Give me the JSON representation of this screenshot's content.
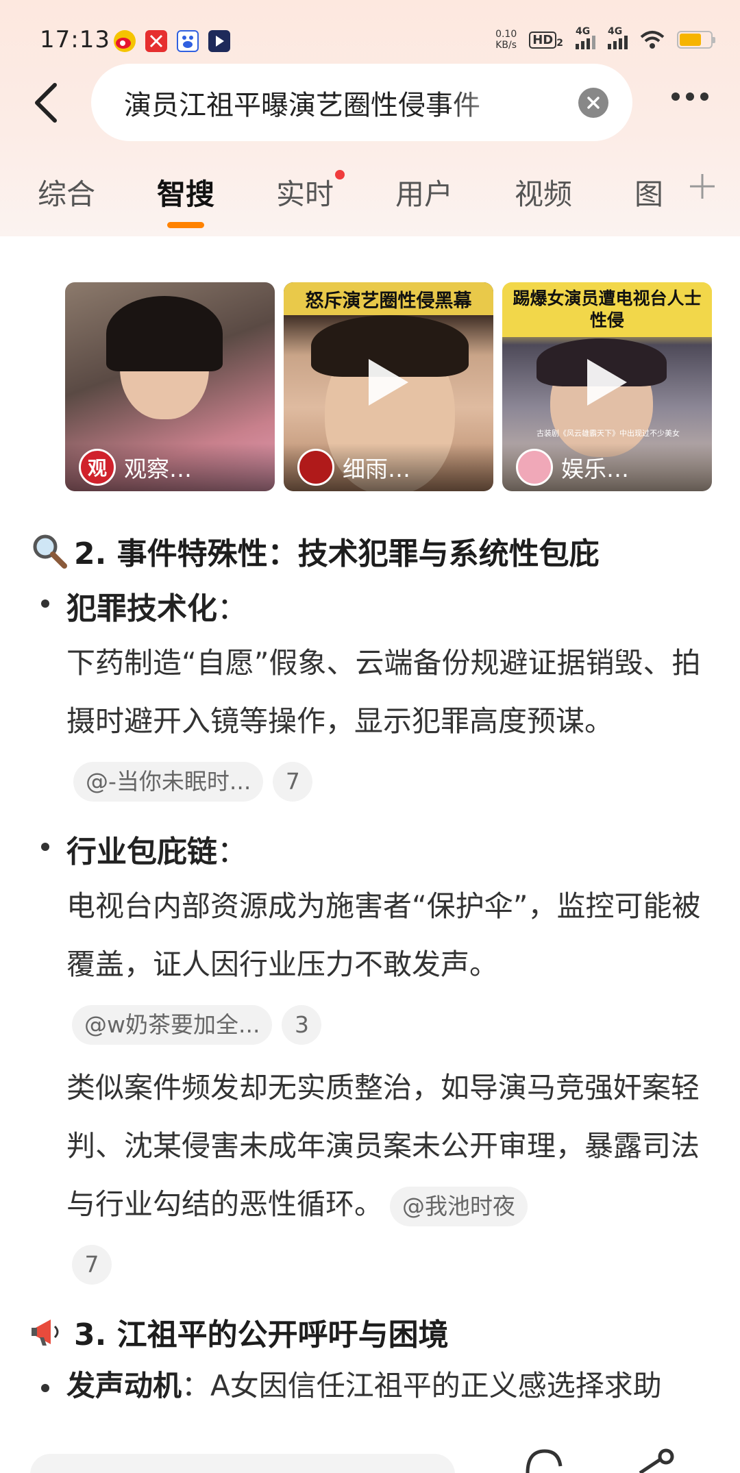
{
  "status_bar": {
    "time": "17:13",
    "net_speed_value": "0.10",
    "net_speed_unit": "KB/s",
    "hd_label": "HD",
    "hd_sub": "2",
    "signal_1": "4G",
    "signal_2": "4G",
    "battery_level": 0.7
  },
  "search": {
    "query": "演员江祖平曝演艺圈性侵事件"
  },
  "tabs": [
    {
      "label": "综合"
    },
    {
      "label": "智搜"
    },
    {
      "label": "实时"
    },
    {
      "label": "用户"
    },
    {
      "label": "视频"
    },
    {
      "label": "图"
    }
  ],
  "active_tab": "智搜",
  "videos": [
    {
      "banner": "",
      "author": "观察…",
      "avatar_text": "观"
    },
    {
      "banner": "怒斥演艺圈性侵黑幕",
      "author": "细雨…",
      "avatar_text": ""
    },
    {
      "banner": "踢爆女演员遭电视台人士性侵",
      "author": "娱乐…",
      "avatar_text": "",
      "caption": "古装剧《风云雄霸天下》中出现过不少美女"
    }
  ],
  "section2": {
    "title": "2. 事件特殊性：技术犯罪与系统性包庇",
    "items": [
      {
        "head": "犯罪技术化",
        "colon": "：",
        "text": "下药制造“自愿”假象、云端备份规避证据销毁、拍摄时避开入镜等操作，显示犯罪高度预谋。",
        "ref": "@-当你未眠时...",
        "count": "7"
      },
      {
        "head": "行业包庇链",
        "colon": "：",
        "text": "电视台内部资源成为施害者“保护伞”，监控可能被覆盖，证人因行业压力不敢发声。",
        "ref": "@w奶茶要加全...",
        "count": "3"
      }
    ],
    "extra_text": "类似案件频发却无实质整治，如导演马竞强奸案轻判、沈某侵害未成年演员案未公开审理，暴露司法与行业勾结的恶性循环。",
    "extra_ref": "@我池时夜",
    "extra_count": "7"
  },
  "section3": {
    "title": "3. 江祖平的公开呼吁与困境",
    "items": [
      {
        "head": "发声动机",
        "colon": "：",
        "text": "A女因信任江祖平的正义感选择求助"
      }
    ]
  },
  "colors": {
    "accent": "#ff8200",
    "badge_dot": "#f03c3c",
    "header_bg": "#fde8df"
  }
}
